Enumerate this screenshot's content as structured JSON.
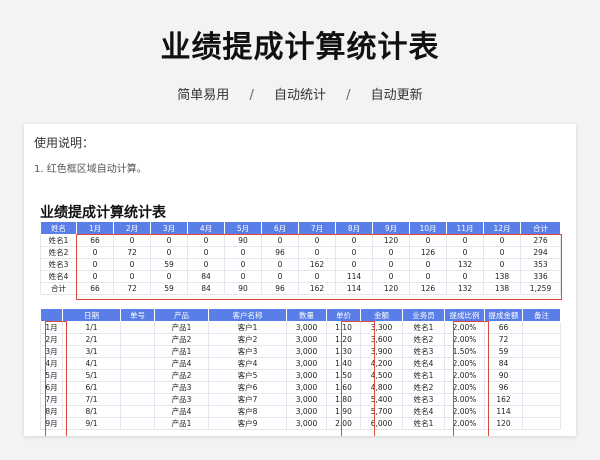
{
  "page": {
    "title": "业绩提成计算统计表",
    "features": [
      "简单易用",
      "自动统计",
      "自动更新"
    ],
    "separator": "/"
  },
  "card": {
    "usage_title": "使用说明：",
    "usage_item": "1. 红色框区域自动计算。",
    "sheet_title": "业绩提成计算统计表"
  },
  "summary": {
    "headers": [
      "姓名",
      "1月",
      "2月",
      "3月",
      "4月",
      "5月",
      "6月",
      "7月",
      "8月",
      "9月",
      "10月",
      "11月",
      "12月",
      "合计"
    ],
    "rows": [
      [
        "姓名1",
        "66",
        "0",
        "0",
        "0",
        "90",
        "0",
        "0",
        "0",
        "120",
        "0",
        "0",
        "0",
        "276"
      ],
      [
        "姓名2",
        "0",
        "72",
        "0",
        "0",
        "0",
        "96",
        "0",
        "0",
        "0",
        "126",
        "0",
        "0",
        "294"
      ],
      [
        "姓名3",
        "0",
        "0",
        "59",
        "0",
        "0",
        "0",
        "162",
        "0",
        "0",
        "0",
        "132",
        "0",
        "353"
      ],
      [
        "姓名4",
        "0",
        "0",
        "0",
        "84",
        "0",
        "0",
        "0",
        "114",
        "0",
        "0",
        "0",
        "138",
        "336"
      ],
      [
        "合计",
        "66",
        "72",
        "59",
        "84",
        "90",
        "96",
        "162",
        "114",
        "120",
        "126",
        "132",
        "138",
        "1,259"
      ]
    ]
  },
  "detail": {
    "headers": [
      "",
      "日期",
      "单号",
      "产品",
      "客户名称",
      "数量",
      "单价",
      "金额",
      "业务员",
      "提成比例",
      "提成金额",
      "备注"
    ],
    "rows": [
      [
        "1月",
        "1/1",
        "",
        "产品1",
        "客户1",
        "3,000",
        "1.10",
        "3,300",
        "姓名1",
        "2.00%",
        "66",
        ""
      ],
      [
        "2月",
        "2/1",
        "",
        "产品2",
        "客户2",
        "3,000",
        "1.20",
        "3,600",
        "姓名2",
        "2.00%",
        "72",
        ""
      ],
      [
        "3月",
        "3/1",
        "",
        "产品1",
        "客户3",
        "3,000",
        "1.30",
        "3,900",
        "姓名3",
        "1.50%",
        "59",
        ""
      ],
      [
        "4月",
        "4/1",
        "",
        "产品4",
        "客户4",
        "3,000",
        "1.40",
        "4,200",
        "姓名4",
        "2.00%",
        "84",
        ""
      ],
      [
        "5月",
        "5/1",
        "",
        "产品2",
        "客户5",
        "3,000",
        "1.50",
        "4,500",
        "姓名1",
        "2.00%",
        "90",
        ""
      ],
      [
        "6月",
        "6/1",
        "",
        "产品3",
        "客户6",
        "3,000",
        "1.60",
        "4,800",
        "姓名2",
        "2.00%",
        "96",
        ""
      ],
      [
        "7月",
        "7/1",
        "",
        "产品3",
        "客户7",
        "3,000",
        "1.80",
        "5,400",
        "姓名3",
        "3.00%",
        "162",
        ""
      ],
      [
        "8月",
        "8/1",
        "",
        "产品4",
        "客户8",
        "3,000",
        "1.90",
        "5,700",
        "姓名4",
        "2.00%",
        "114",
        ""
      ],
      [
        "9月",
        "9/1",
        "",
        "产品1",
        "客户9",
        "3,000",
        "2.00",
        "6,000",
        "姓名1",
        "2.00%",
        "120",
        ""
      ]
    ]
  },
  "colors": {
    "header_bg": "#5a7ee8",
    "highlight_border": "#e0463c"
  }
}
